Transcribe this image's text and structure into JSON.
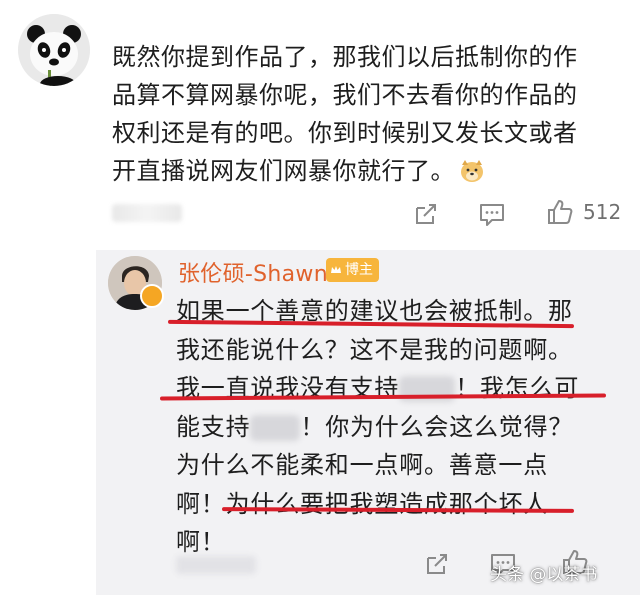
{
  "comment": {
    "avatar_icon": "panda-avatar",
    "lines": [
      "既然你提到作品了，那我们以后抵制你的作",
      "品算不算网暴你呢，我们不去看你的作品的",
      "权利还是有的吧。你到时候别又发长文或者",
      "开直播说网友们网暴你就行了。"
    ],
    "emoji_icon": "doge-emoji",
    "actions": {
      "share_icon": "share-icon",
      "comment_icon": "comment-icon",
      "like_icon": "like-icon",
      "like_count": "512"
    }
  },
  "reply": {
    "author_name": "张伦硕-Shawn",
    "badge_label": "博主",
    "badge_color": "#f7b53c",
    "name_color": "#e0622c",
    "lines": [
      "如果一个善意的建议也会被抵制。那",
      "我还能说什么？这不是我的问题啊。",
      "我一直说我没有支持",
      "！我怎么可",
      "能支持",
      "！你为什么会这么觉得？",
      "为什么不能柔和一点啊。善意一点",
      "啊！为什么要把我塑造成那个坏人",
      "啊！"
    ],
    "underline_color": "#d81f2a",
    "actions": {
      "share_icon": "share-icon",
      "comment_icon": "comment-icon",
      "like_icon": "like-icon"
    }
  },
  "watermark": "头条 @以茶书"
}
